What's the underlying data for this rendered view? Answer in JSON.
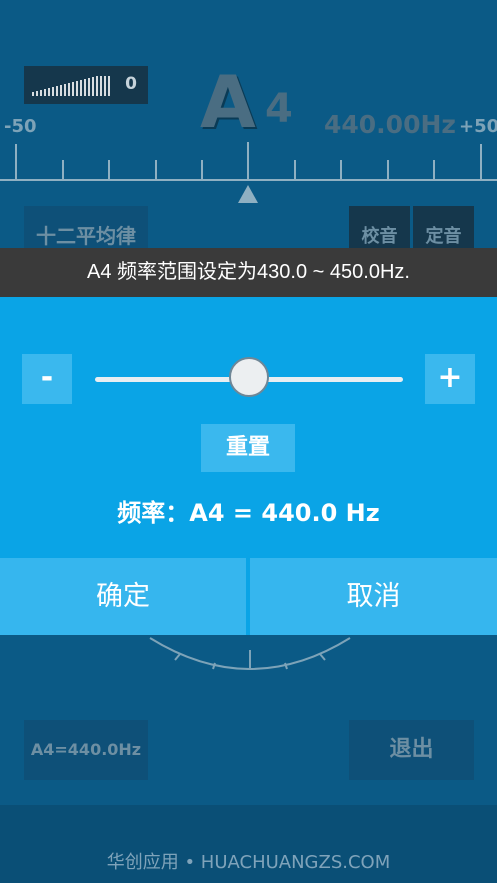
{
  "tuner": {
    "volume_value": "0",
    "note_letter": "A",
    "note_octave": "4",
    "frequency": "440.00Hz",
    "scale_min": "-50",
    "scale_max": "+50",
    "temperament_label": "十二平均律",
    "calibrate_label": "校音",
    "tune_label": "定音",
    "reference_label": "A4=440.0Hz",
    "exit_label": "退出"
  },
  "toast": {
    "message": "A4 频率范围设定为430.0 ~ 450.0Hz."
  },
  "dialog": {
    "minus_label": "-",
    "plus_label": "+",
    "slider_fraction": 0.5,
    "slider_range": "430.0 ~ 450.0",
    "reset_label": "重置",
    "frequency_text": "频率：A4 = 440.0 Hz",
    "confirm_label": "确定",
    "cancel_label": "取消"
  },
  "footer": {
    "text": "华创应用 • HUACHUANGZS.COM"
  },
  "colors": {
    "background": "#0b5a86",
    "dialog": "#0aa4e6",
    "dialog_button": "#36b6ee",
    "toast": "#3a3a3a"
  }
}
